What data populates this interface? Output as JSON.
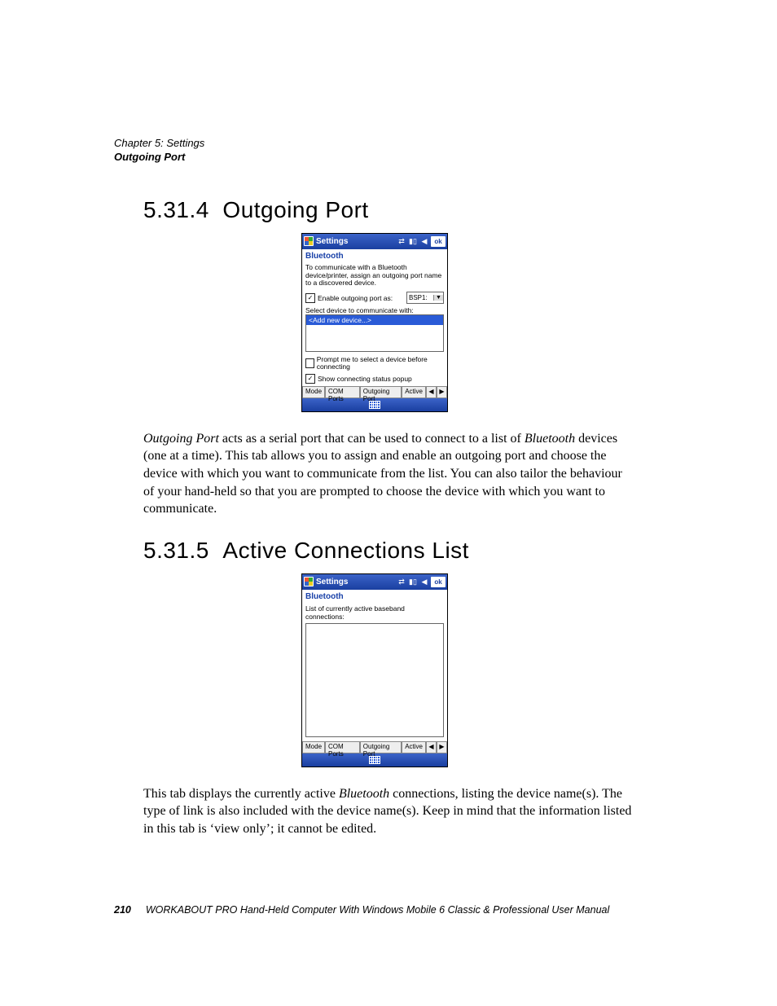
{
  "header": {
    "chapter": "Chapter 5: Settings",
    "section": "Outgoing Port"
  },
  "sections": {
    "s1": {
      "number": "5.31.4",
      "title": "Outgoing Port"
    },
    "s2": {
      "number": "5.31.5",
      "title": "Active Connections List"
    }
  },
  "paragraphs": {
    "p1_a": "Outgoing Port",
    "p1_b": " acts as a serial port that can be used to connect to a list of ",
    "p1_c": "Bluetooth",
    "p1_d": " devices (one at a time). This tab allows you to assign and enable an outgoing port and choose the device with which you want to communicate from the list. You can also tailor the behaviour of your hand-held so that you are prompted to choose the device with which you want to communicate.",
    "p2_a": "This tab displays the currently active ",
    "p2_b": "Bluetooth",
    "p2_c": " connections, listing the device name(s). The type of link is also included with the device name(s). Keep in mind that the information listed in this tab is ‘view only’; it cannot be edited."
  },
  "shot_common": {
    "window_title": "Settings",
    "ok": "ok",
    "bluetooth": "Bluetooth",
    "tabs": {
      "mode": "Mode",
      "com": "COM Ports",
      "out": "Outgoing Port",
      "act": "Active"
    }
  },
  "shot1": {
    "desc": "To communicate with a Bluetooth device/printer, assign an outgoing port name to a discovered device.",
    "enable_label": "Enable outgoing port as:",
    "port_value": "BSP1:",
    "select_label": "Select device to communicate with:",
    "add_device": "<Add new device...>",
    "prompt_label": "Prompt me to select a device before connecting",
    "show_label": "Show connecting status popup"
  },
  "shot2": {
    "desc": "List of currently active baseband connections:"
  },
  "footer": {
    "page": "210",
    "title": "WORKABOUT PRO Hand-Held Computer With Windows Mobile 6 Classic & Professional User Manual"
  }
}
